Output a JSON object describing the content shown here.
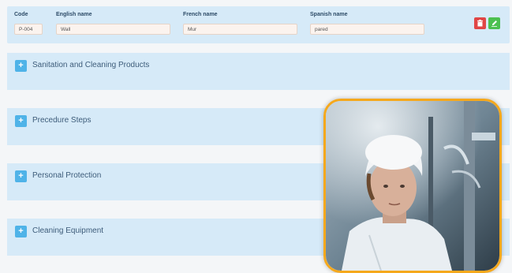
{
  "edit_row": {
    "columns": [
      {
        "label": "Code",
        "value": "P-004"
      },
      {
        "label": "English name",
        "value": "Wall"
      },
      {
        "label": "French name",
        "value": "Mur"
      },
      {
        "label": "Spanish name",
        "value": "pared"
      }
    ],
    "actions": {
      "delete_icon": "trash-icon",
      "edit_icon": "edit-icon",
      "delete_color": "#e04646",
      "edit_color": "#4cc04f"
    }
  },
  "sections": [
    {
      "title": "Sanitation and Cleaning Products",
      "toggle_symbol": "+"
    },
    {
      "title": "Precedure Steps",
      "toggle_symbol": "+"
    },
    {
      "title": "Personal Protection",
      "toggle_symbol": "+"
    },
    {
      "title": "Cleaning Equipment",
      "toggle_symbol": "+"
    }
  ],
  "photo": {
    "subject": "worker-in-hairnet",
    "border_color": "#f5a81c"
  },
  "colors": {
    "panel": "#d6eaf8",
    "toggle": "#4fb3e8",
    "section_text": "#3d5c7a",
    "label_text": "#2c4a66"
  }
}
